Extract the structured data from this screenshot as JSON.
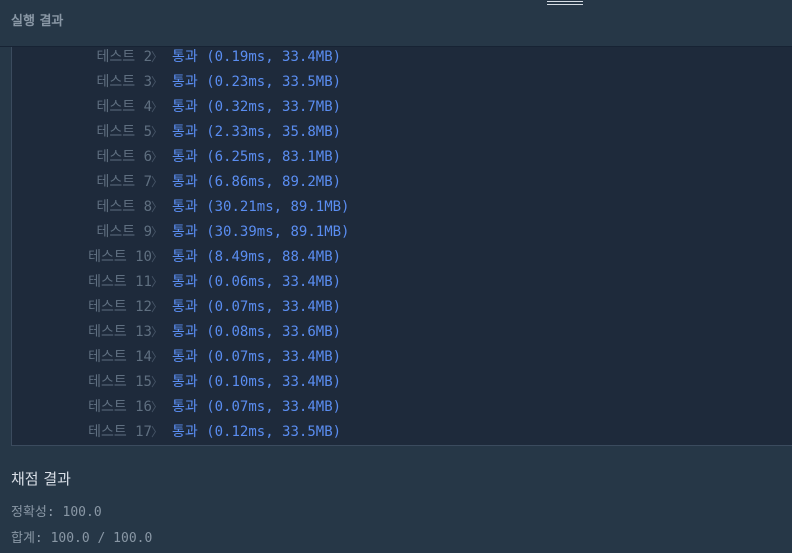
{
  "header": {
    "title": "실행 결과"
  },
  "tests": [
    {
      "label": "테스트 2",
      "result": "통과 (0.19ms, 33.4MB)"
    },
    {
      "label": "테스트 3",
      "result": "통과 (0.23ms, 33.5MB)"
    },
    {
      "label": "테스트 4",
      "result": "통과 (0.32ms, 33.7MB)"
    },
    {
      "label": "테스트 5",
      "result": "통과 (2.33ms, 35.8MB)"
    },
    {
      "label": "테스트 6",
      "result": "통과 (6.25ms, 83.1MB)"
    },
    {
      "label": "테스트 7",
      "result": "통과 (6.86ms, 89.2MB)"
    },
    {
      "label": "테스트 8",
      "result": "통과 (30.21ms, 89.1MB)"
    },
    {
      "label": "테스트 9",
      "result": "통과 (30.39ms, 89.1MB)"
    },
    {
      "label": "테스트 10",
      "result": "통과 (8.49ms, 88.4MB)"
    },
    {
      "label": "테스트 11",
      "result": "통과 (0.06ms, 33.4MB)"
    },
    {
      "label": "테스트 12",
      "result": "통과 (0.07ms, 33.4MB)"
    },
    {
      "label": "테스트 13",
      "result": "통과 (0.08ms, 33.6MB)"
    },
    {
      "label": "테스트 14",
      "result": "통과 (0.07ms, 33.4MB)"
    },
    {
      "label": "테스트 15",
      "result": "통과 (0.10ms, 33.4MB)"
    },
    {
      "label": "테스트 16",
      "result": "통과 (0.07ms, 33.4MB)"
    },
    {
      "label": "테스트 17",
      "result": "통과 (0.12ms, 33.5MB)"
    }
  ],
  "chevron_glyph": "〉",
  "grading": {
    "title": "채점 결과",
    "accuracy": "정확성: 100.0",
    "total": "합계: 100.0 / 100.0"
  },
  "colors": {
    "background": "#263747",
    "panel": "#1e2a3b",
    "pass": "#5a8df1",
    "label": "#5f6f80"
  }
}
